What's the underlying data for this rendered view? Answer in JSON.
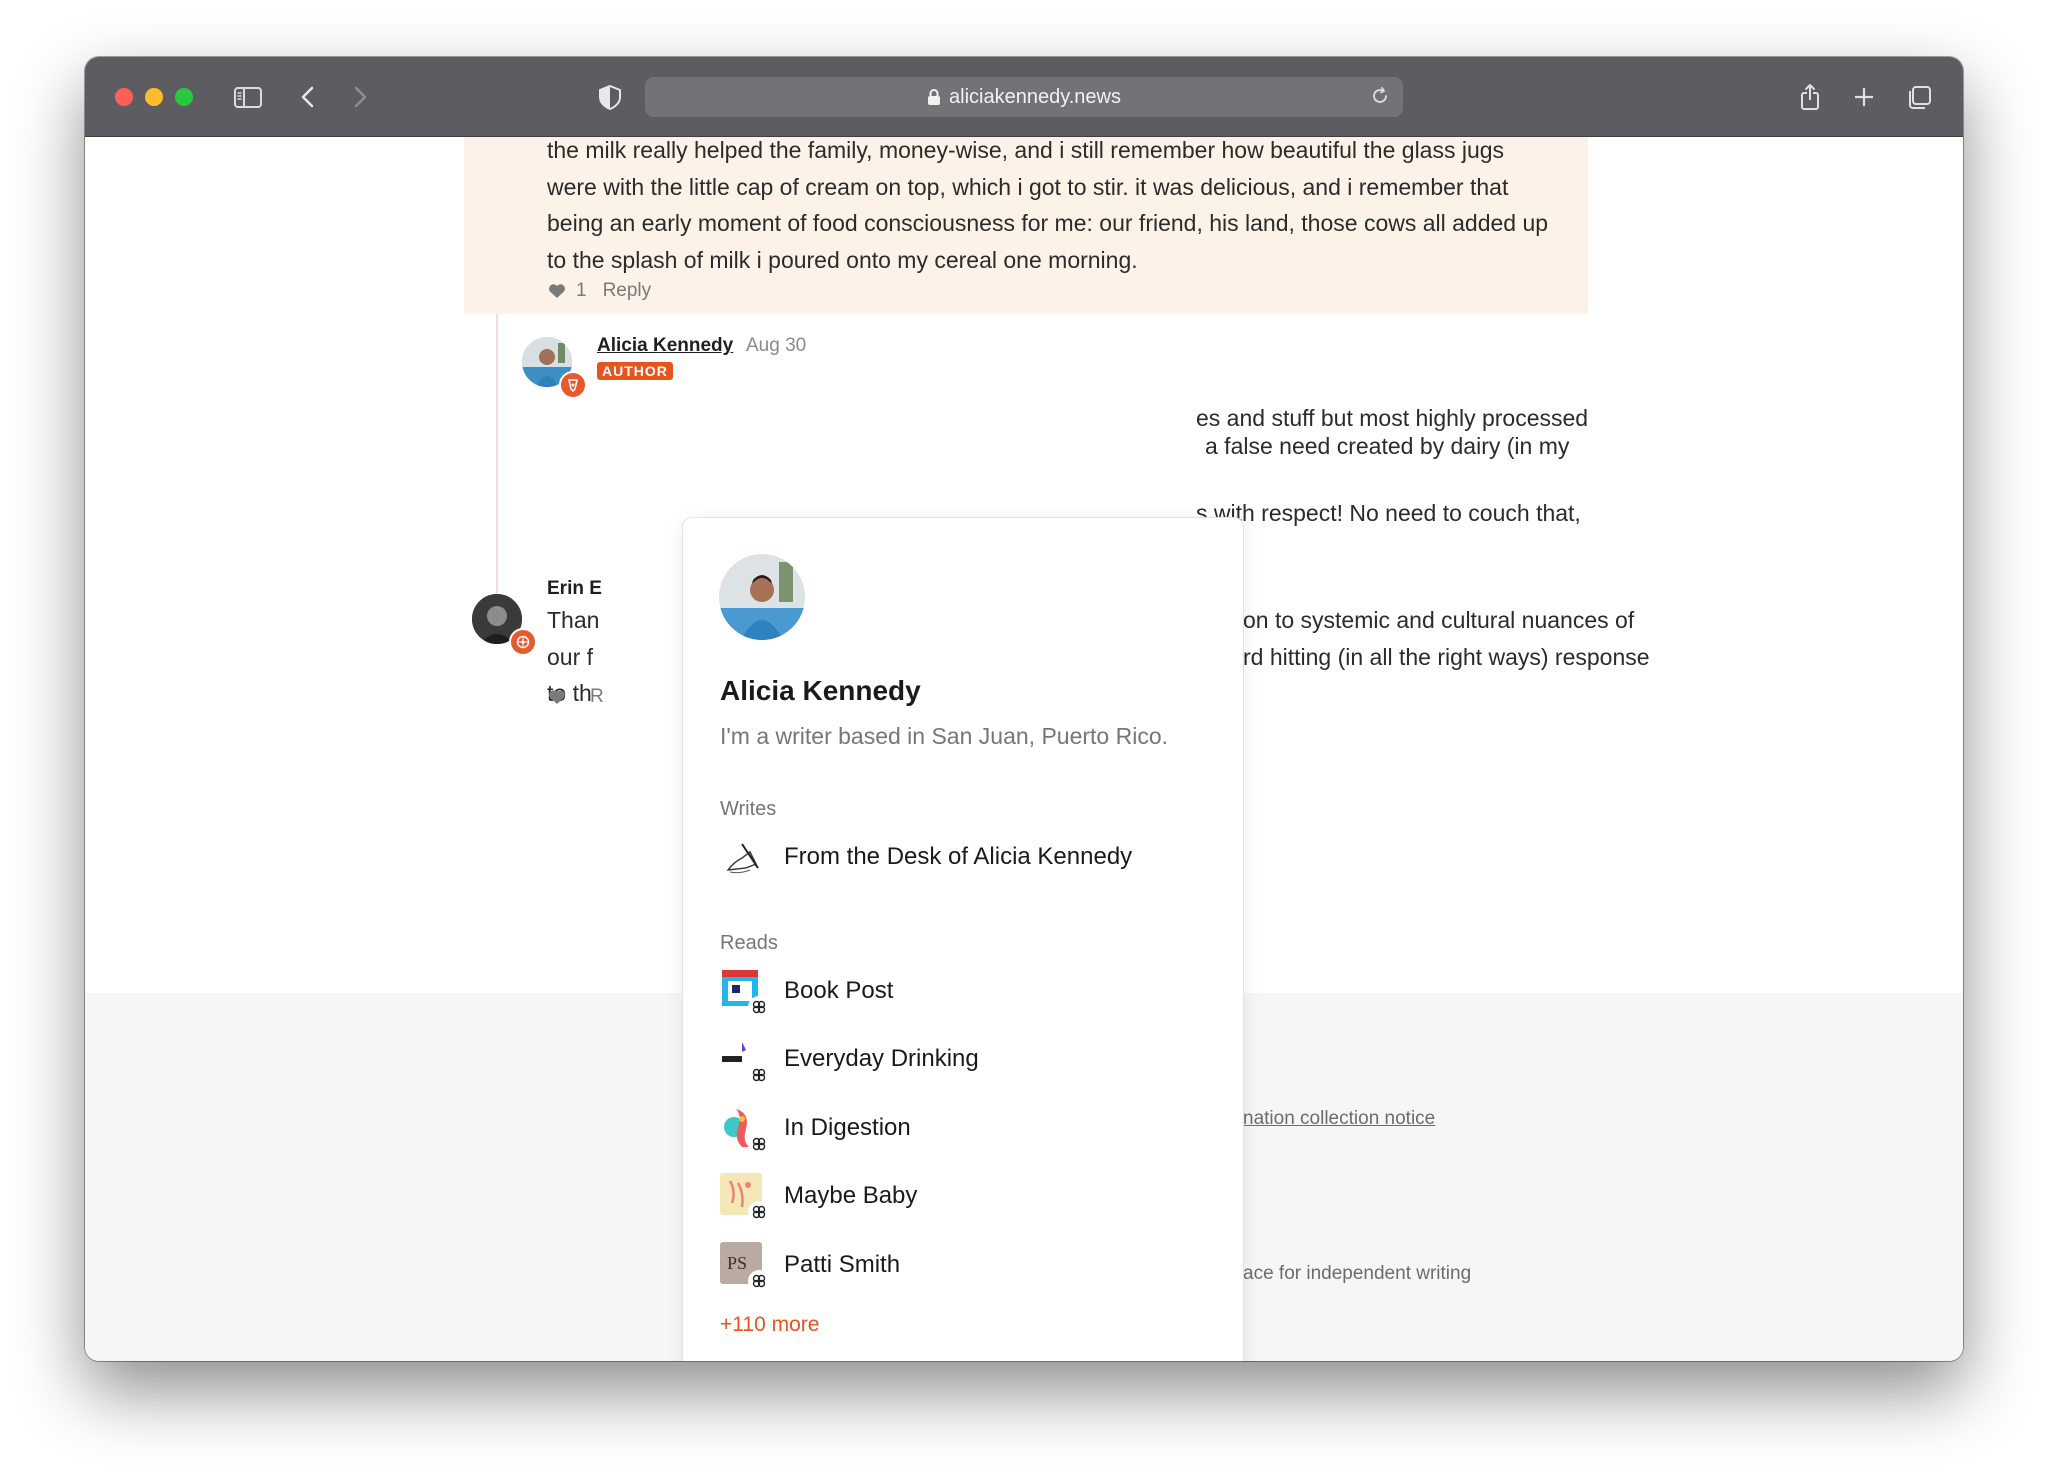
{
  "browser": {
    "url": "aliciakennedy.news"
  },
  "comment_top": {
    "lines": [
      "the milk really helped the family, money-wise, and i still remember how beautiful the glass jugs",
      "were with the little cap of cream on top, which i got to stir. it was delicious, and i remember that",
      "being an early moment of food consciousness for me: our friend, his land, those cows all added up",
      "to the splash of milk i poured onto my cereal one morning."
    ],
    "like_count": "1",
    "reply_label": "Reply"
  },
  "comment_author": {
    "name": "Alicia Kennedy",
    "date": "Aug 30",
    "tag": "AUTHOR",
    "lines_partial": [
      "es and stuff but most highly processed",
      "a false need created by dairy (in my",
      "s with respect! No need to couch that,"
    ]
  },
  "comment_erin": {
    "name": "Erin E",
    "lines_left": [
      "Than",
      "our f",
      "to th"
    ],
    "lines_right": [
      "on to systemic and cultural nuances of",
      "rd hitting (in all the right ways) response"
    ],
    "reply_partial": "R"
  },
  "footer": {
    "link_partial": "nation collection notice",
    "tagline_partial": "ace for independent writing"
  },
  "popover": {
    "name": "Alicia Kennedy",
    "bio": "I'm a writer based in San Juan, Puerto Rico.",
    "writes_label": "Writes",
    "writes": [
      {
        "name": "From the Desk of Alicia Kennedy",
        "icon": "hand-drawing-icon"
      }
    ],
    "reads_label": "Reads",
    "reads": [
      {
        "name": "Book Post",
        "icon": "book-post-icon",
        "color": "#23b6e8"
      },
      {
        "name": "Everyday Drinking",
        "icon": "everyday-drinking-icon",
        "color": "#ffffff"
      },
      {
        "name": "In Digestion",
        "icon": "in-digestion-icon",
        "color": "#ef6b6b"
      },
      {
        "name": "Maybe Baby",
        "icon": "maybe-baby-icon",
        "color": "#f6e7b8"
      },
      {
        "name": "Patti Smith",
        "icon": "patti-smith-icon",
        "color": "#b9aba3"
      }
    ],
    "more_label": "+110 more"
  },
  "colors": {
    "accent": "#e8541e",
    "highlight_bg": "#fcf2e7",
    "toolbar_bg": "#5d5c61"
  }
}
